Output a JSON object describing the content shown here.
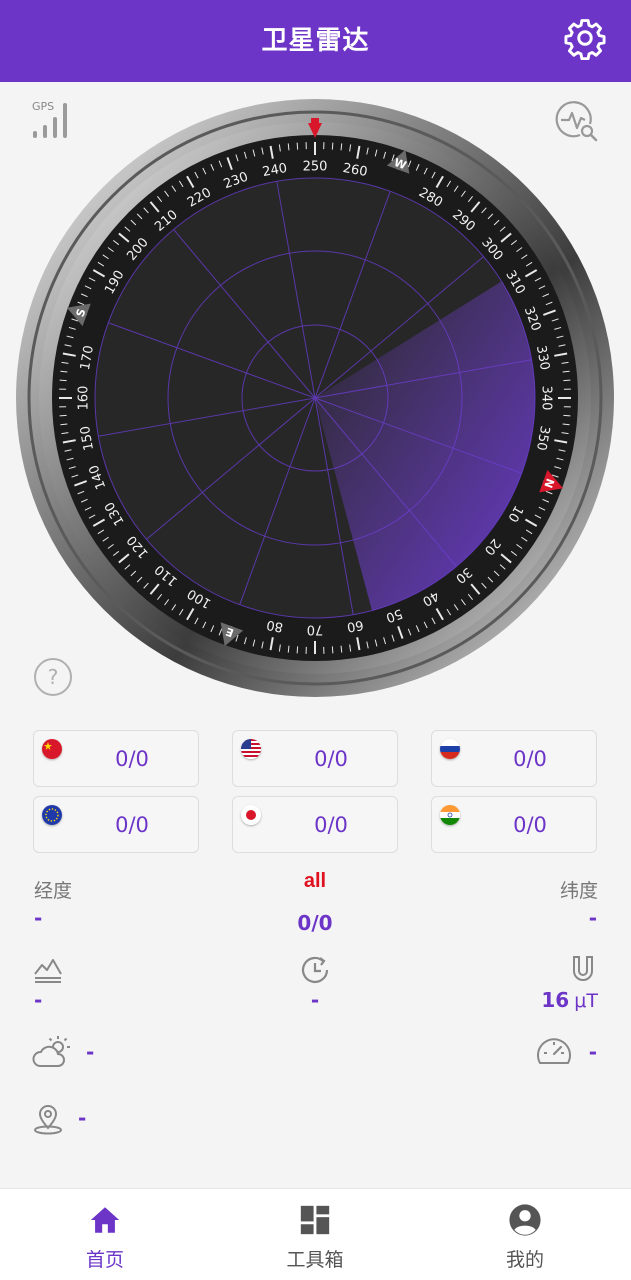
{
  "header": {
    "title": "卫星雷达"
  },
  "gps_label": "GPS",
  "compass": {
    "ticks": [
      "10",
      "20",
      "30",
      "40",
      "50",
      "60",
      "70",
      "80",
      "100",
      "110",
      "120",
      "130",
      "140",
      "150",
      "160",
      "170",
      "190",
      "200",
      "210",
      "220",
      "230",
      "240",
      "250",
      "260",
      "280",
      "290",
      "300",
      "310",
      "320",
      "330",
      "340",
      "350"
    ],
    "cardinals": [
      "N",
      "E",
      "S",
      "W"
    ]
  },
  "satellites": [
    {
      "system": "china",
      "count": "0/0"
    },
    {
      "system": "usa",
      "count": "0/0"
    },
    {
      "system": "russia",
      "count": "0/0"
    },
    {
      "system": "europe",
      "count": "0/0"
    },
    {
      "system": "japan",
      "count": "0/0"
    },
    {
      "system": "india",
      "count": "0/0"
    }
  ],
  "info": {
    "longitude_label": "经度",
    "longitude_value": "-",
    "all_label": "all",
    "all_value": "0/0",
    "latitude_label": "纬度",
    "latitude_value": "-",
    "altitude_value": "-",
    "time_value": "-",
    "magnetic_value": "16",
    "magnetic_unit": "μT",
    "weather_value": "-",
    "speed_value": "-",
    "location_value": "-"
  },
  "nav": [
    {
      "label": "首页",
      "icon": "home-icon",
      "active": true
    },
    {
      "label": "工具箱",
      "icon": "dashboard-icon",
      "active": false
    },
    {
      "label": "我的",
      "icon": "account-icon",
      "active": false
    }
  ],
  "colors": {
    "accent": "#6c35c8",
    "header": "#6c35c8",
    "north": "#d8182a"
  }
}
